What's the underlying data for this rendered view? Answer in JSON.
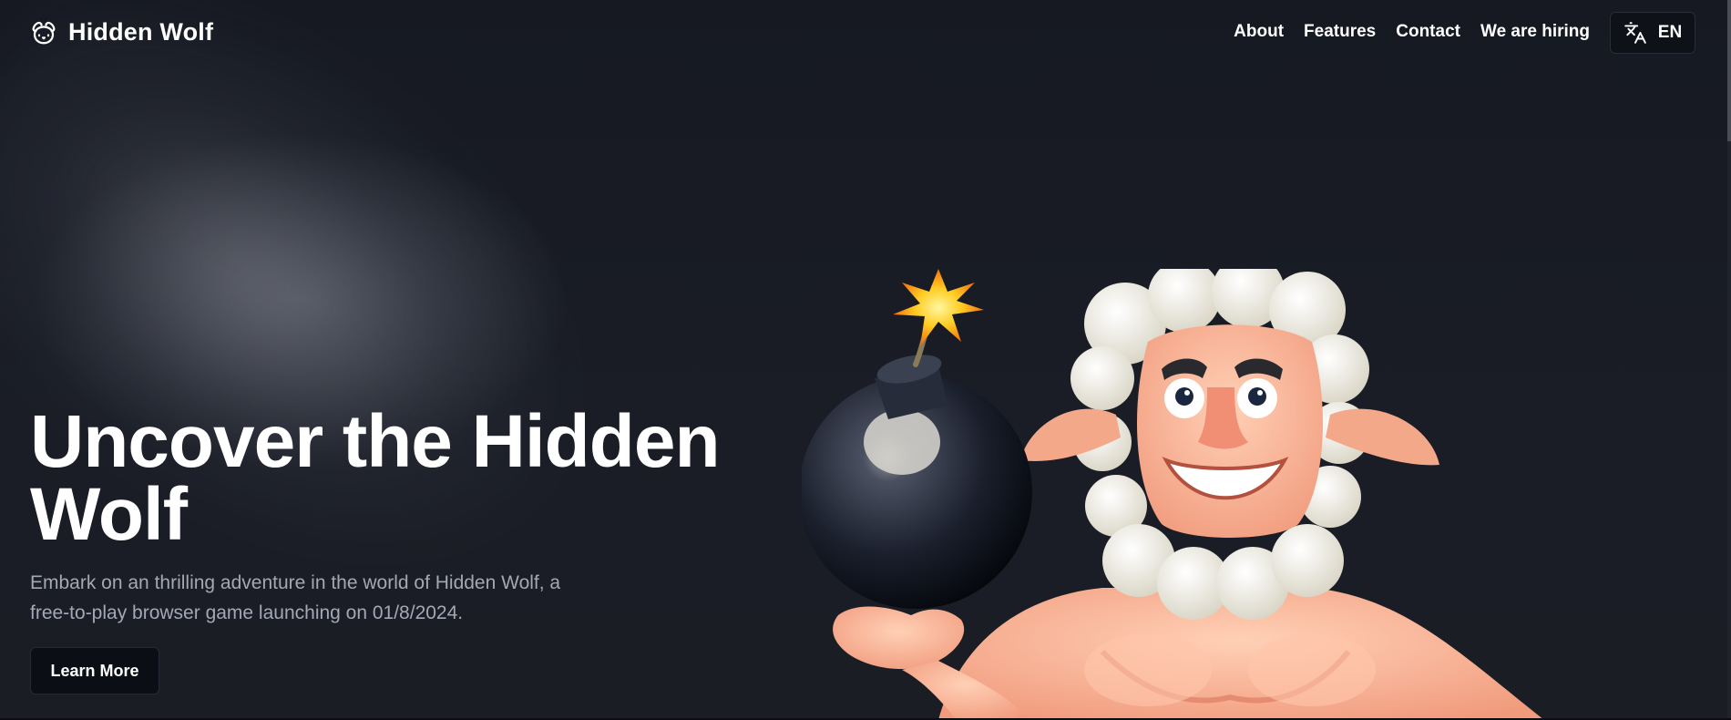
{
  "brand": {
    "name": "Hidden Wolf",
    "icon": "dog-face-icon"
  },
  "nav": {
    "items": [
      {
        "label": "About"
      },
      {
        "label": "Features"
      },
      {
        "label": "Contact"
      },
      {
        "label": "We are hiring"
      }
    ]
  },
  "language": {
    "icon": "translate-icon",
    "label": "EN"
  },
  "hero": {
    "title_line1": "Uncover the Hidden",
    "title_line2": "Wolf",
    "description_line1": "Embark on an thrilling adventure in the world of Hidden Wolf, a",
    "description_line2": "free-to-play browser game launching on 01/8/2024.",
    "cta_label": "Learn More",
    "image": "muscular-sheep-holding-bomb-illustration"
  },
  "colors": {
    "background": "#181b24",
    "button_bg": "#0c0e15",
    "text_muted": "#a4a8b4"
  }
}
